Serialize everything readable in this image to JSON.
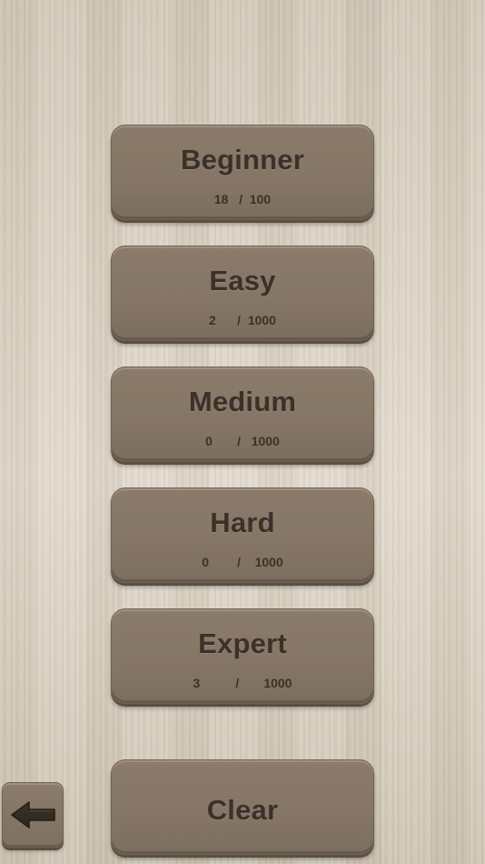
{
  "levels": [
    {
      "name": "Beginner",
      "completed": "18",
      "separator": "/",
      "total": "100"
    },
    {
      "name": "Easy",
      "completed": "2",
      "separator": "/",
      "total": "1000"
    },
    {
      "name": "Medium",
      "completed": "0",
      "separator": "/",
      "total": "1000"
    },
    {
      "name": "Hard",
      "completed": "0",
      "separator": "/",
      "total": "1000"
    },
    {
      "name": "Expert",
      "completed": "3",
      "separator": "/",
      "total": "1000"
    }
  ],
  "clear_label": "Clear",
  "back_icon": "left-arrow-icon",
  "colors": {
    "button_face": "#857666",
    "button_text": "#3b3129",
    "background": "#ddd4c6"
  }
}
